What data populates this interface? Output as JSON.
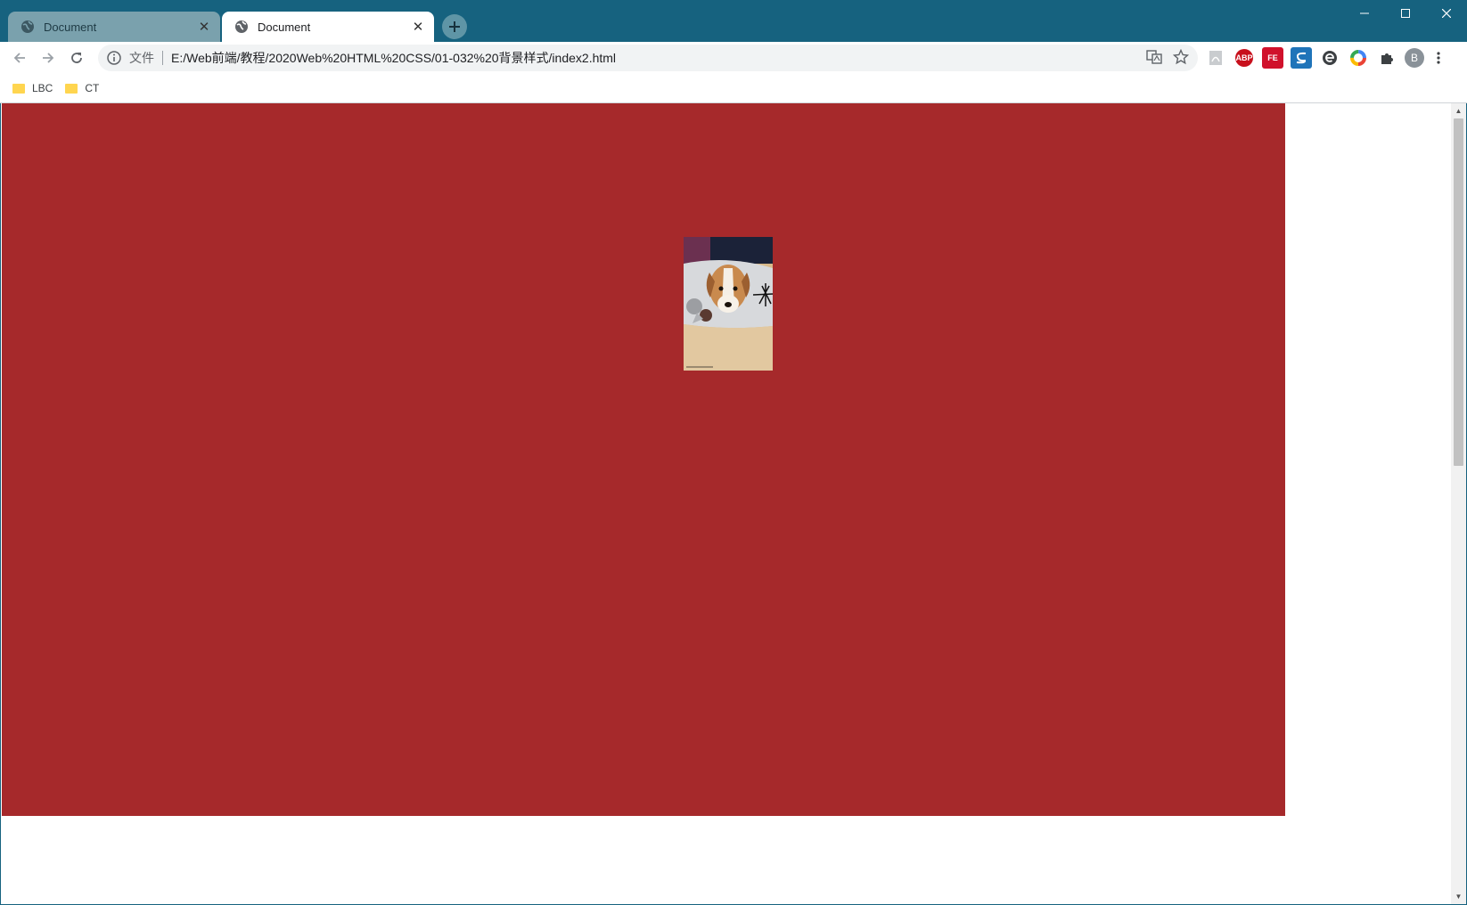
{
  "tabs": [
    {
      "title": "Document",
      "active": false
    },
    {
      "title": "Document",
      "active": true
    }
  ],
  "toolbar": {
    "file_label": "文件",
    "url": "E:/Web前端/教程/2020Web%20HTML%20CSS/01-032%20背景样式/index2.html"
  },
  "extensions": {
    "abp_label": "ABP",
    "fe_label": "FE",
    "avatar_letter": "B"
  },
  "bookmarks": [
    {
      "label": "LBC"
    },
    {
      "label": "CT"
    }
  ],
  "page": {
    "box_color": "#a6292b",
    "image_alt": "puppy lying on a patterned cushion"
  },
  "colors": {
    "titlebar": "#16627f",
    "accent": "#a6292b"
  }
}
